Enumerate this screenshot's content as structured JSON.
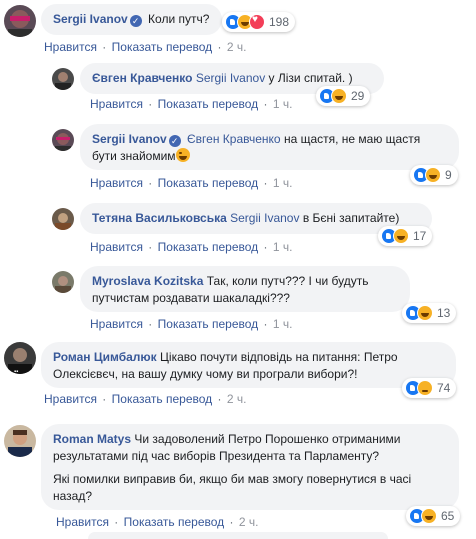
{
  "actions": {
    "like": "Нравится",
    "translate": "Показать перевод",
    "separator": "·"
  },
  "comments": [
    {
      "author": "Sergii Ivanov",
      "verified": true,
      "text": "Коли путч?",
      "time": "2 ч.",
      "reactions": {
        "icons": [
          "like-icon",
          "haha-icon",
          "love-icon"
        ],
        "count": "198"
      }
    },
    {
      "author": "Євген Кравченко",
      "mention": "Sergii Ivanov",
      "text": "у Лізи спитай. )",
      "time": "1 ч.",
      "reactions": {
        "icons": [
          "like-icon",
          "haha-icon"
        ],
        "count": "29"
      }
    },
    {
      "author": "Sergii Ivanov",
      "verified": true,
      "mention": "Євген Кравченко",
      "text_line1": "на щастя, не маю щастя",
      "text_line2": "бути знайомим",
      "time": "1 ч.",
      "reactions": {
        "icons": [
          "like-icon",
          "haha-icon"
        ],
        "count": "9"
      }
    },
    {
      "author": "Тетяна Васильковська",
      "mention": "Sergii Ivanov",
      "text": "в Бєні запитайте)",
      "time": "1 ч.",
      "reactions": {
        "icons": [
          "like-icon",
          "haha-icon"
        ],
        "count": "17"
      }
    },
    {
      "author": "Myroslava Kozitska",
      "text_line1": "Так, коли путч??? І чи будуть",
      "text_line2": "путчистам роздавати шакаладкі???",
      "time": "1 ч.",
      "reactions": {
        "icons": [
          "like-icon",
          "haha-icon"
        ],
        "count": "13"
      }
    },
    {
      "author": "Роман Цимбалюк",
      "text_line1": "Цікаво почути відповідь на питання: Петро",
      "text_line2": "Олексієвєч, на вашу думку чому ви програли вибори?!",
      "time": "2 ч.",
      "reactions": {
        "icons": [
          "like-icon",
          "sad-icon"
        ],
        "count": "74"
      }
    },
    {
      "author": "Roman Matys",
      "text_line1": "Чи задоволений Петро Порошенко отриманими",
      "text_line2": "результатами під час виборів Президента та Парламенту?",
      "text_line3": "Які помилки виправив би, якщо би мав змогу повернутися в часі",
      "text_line4": "назад?",
      "time": "2 ч.",
      "reactions": {
        "icons": [
          "like-icon",
          "haha-icon"
        ],
        "count": "65"
      }
    }
  ]
}
